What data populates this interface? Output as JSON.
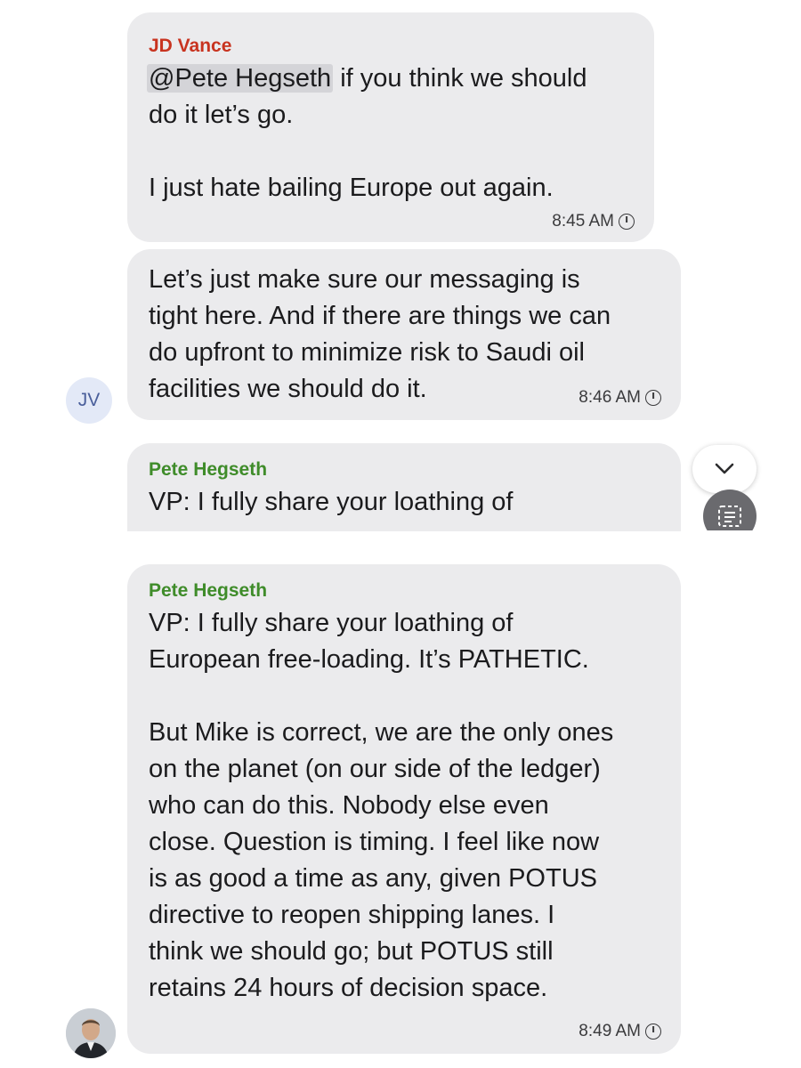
{
  "messages": [
    {
      "sender": "JD Vance",
      "sender_color": "#c8331f",
      "mention": "@Pete Hegseth",
      "lines": [
        "if you think we should",
        "do it let’s go.",
        "",
        "I just hate bailing Europe out again."
      ],
      "time": "8:45 AM"
    },
    {
      "lines": [
        "Let’s just make sure our messaging is",
        "tight here. And if there are things we can",
        "do upfront to minimize risk to Saudi oil",
        "facilities we should do it."
      ],
      "time": "8:46 AM",
      "avatar_initials": "JV"
    },
    {
      "sender": "Pete Hegseth",
      "sender_color": "#3f8c2a",
      "lines": [
        "VP: I fully share your loathing of"
      ]
    },
    {
      "sender": "Pete Hegseth",
      "sender_color": "#3f8c2a",
      "lines": [
        "VP: I fully share your loathing of",
        "European free-loading. It’s PATHETIC.",
        "",
        "But Mike is correct, we are the only ones",
        "on the planet (on our side of the ledger)",
        "who can do this. Nobody else even",
        "close. Question is timing. I feel like now",
        "is as good a time as any, given POTUS",
        "directive to reopen shipping lanes. I",
        "think we should go; but POTUS still",
        "retains 24 hours of decision space."
      ],
      "time": "8:49 AM"
    }
  ],
  "icons": {
    "scroll_down": "chevron-down-icon",
    "summary": "summary-icon",
    "clock": "clock-icon"
  }
}
